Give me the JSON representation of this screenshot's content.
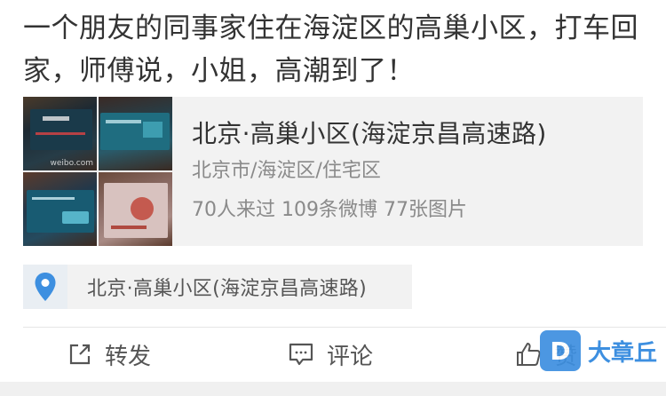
{
  "post": {
    "text": "一个朋友的同事家住在海淀区的高巢小区，打车回家，师傅说，小姐，高潮到了！"
  },
  "location_card": {
    "title": "北京·高巢小区(海淀京昌高速路)",
    "subtitle": "北京市/海淀区/住宅区",
    "stats": "70人来过 109条微博 77张图片",
    "thumbnail_watermark": "weibo.com"
  },
  "location_tag": {
    "label": "北京·高巢小区(海淀京昌高速路)",
    "icon": "location-pin-icon",
    "pin_color": "#3d8fe0"
  },
  "actions": {
    "repost_label": "转发",
    "comment_label": "评论",
    "like_label": "赞"
  },
  "brand": {
    "badge_letter": "D",
    "name": "大章丘",
    "color": "#3d8fe0"
  }
}
